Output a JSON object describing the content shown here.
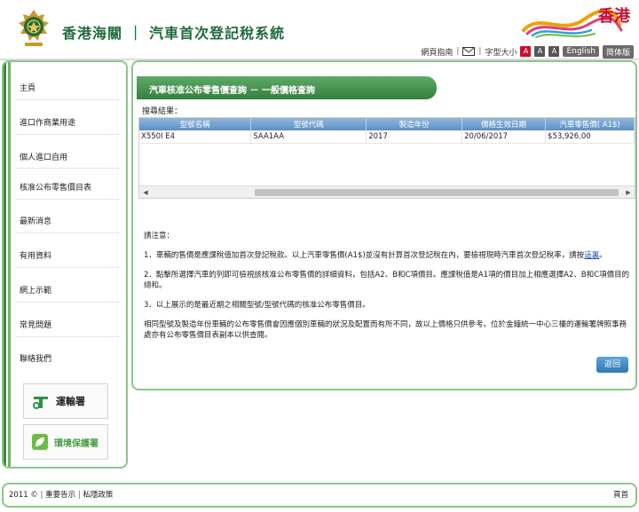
{
  "header": {
    "site_title": "香港海關 ｜ 汽車首次登記稅系統",
    "brand_text": "香港",
    "util": {
      "sitemap": "網頁指南",
      "font_size": "字型大小",
      "font_small": "A",
      "font_medium": "A",
      "font_large": "A",
      "english": "English",
      "simplified": "简体版"
    }
  },
  "sidebar": {
    "items": [
      {
        "label": "主頁"
      },
      {
        "label": "進口作商業用途"
      },
      {
        "label": "個人進口自用"
      },
      {
        "label": "核准公布零售價目表"
      },
      {
        "label": "最新消息"
      },
      {
        "label": "有用資料"
      },
      {
        "label": "網上示範"
      },
      {
        "label": "常見問題"
      },
      {
        "label": "聯絡我們"
      }
    ],
    "partners": {
      "td": "運輸署",
      "epd": "環境保護署"
    }
  },
  "main": {
    "title": "汽車核准公布零售價查詢 － 一般價格查詢",
    "results_label": "搜尋結果：",
    "table": {
      "headers": [
        "型號名稱",
        "型號代碼",
        "製造年份",
        "價格生效日期",
        "汽車零售價( A1$)"
      ],
      "rows": [
        [
          "X550I E4",
          "SAA1AA",
          "2017",
          "20/06/2017",
          "$53,926.00"
        ]
      ]
    },
    "notes": {
      "heading": "請注意：",
      "n1_text": "1．車輛的售價是應課稅值加首次登記稅款。以上汽車零售價(A1$)並沒有計算首次登記稅在內，要檢視現時汽車首次登記稅率，請按",
      "n1_link": "這裏",
      "n1_end": "。",
      "n2": "2．點擊所選擇汽車的列即可檢視該核准公布零售價的詳細資料，包括A2、B和C項價目。應課稅值是A1項的價目加上相應選擇A2、B和C項價目的總和。",
      "n3": "3．以上展示的是最近期之相關型號/型號代碼的核准公布零售價目。",
      "n4": "相同型號及製造年份車輛的公布零售價會因應個別車輛的狀況及配置而有所不同，故以上價格只供參考。位於金鐘統一中心三樓的運輸署牌照事務處亦有公布零售價目表副本以供查閱。"
    },
    "back_button": "返回"
  },
  "footer": {
    "copyright": "2011 ©",
    "notice": "重要告示",
    "privacy": "私隱政策",
    "top": "頁首"
  },
  "colors": {
    "primary_green": "#367f40",
    "border_green": "#8bc68b",
    "table_header_blue": "#5d8fc4",
    "accent_red": "#c8102e"
  },
  "icons": [
    "customs-emblem-icon",
    "brand-hong-kong-icon",
    "mail-icon",
    "transport-department-icon",
    "environmental-protection-icon"
  ]
}
